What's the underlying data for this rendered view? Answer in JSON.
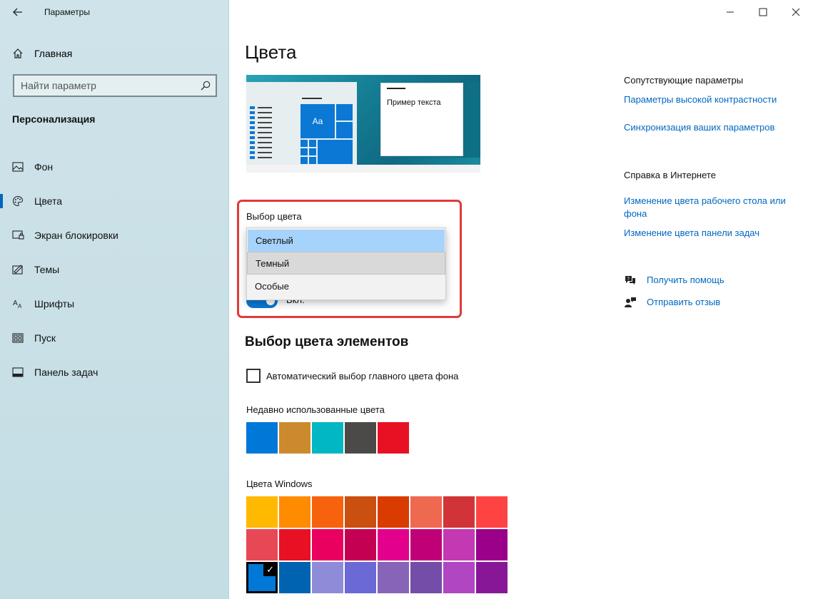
{
  "app": {
    "title": "Параметры"
  },
  "sidebar": {
    "home_label": "Главная",
    "search_placeholder": "Найти параметр",
    "section_title": "Персонализация",
    "items": [
      {
        "label": "Фон",
        "icon": "image-icon"
      },
      {
        "label": "Цвета",
        "icon": "palette-icon",
        "active": true
      },
      {
        "label": "Экран блокировки",
        "icon": "lock-screen-icon"
      },
      {
        "label": "Темы",
        "icon": "themes-icon"
      },
      {
        "label": "Шрифты",
        "icon": "fonts-icon"
      },
      {
        "label": "Пуск",
        "icon": "start-icon"
      },
      {
        "label": "Панель задач",
        "icon": "taskbar-icon"
      }
    ]
  },
  "main": {
    "title": "Цвета",
    "preview_text": "Пример текста",
    "preview_tile_label": "Aa",
    "choose_color_label": "Выбор цвета",
    "dropdown_options": [
      "Светлый",
      "Темный",
      "Особые"
    ],
    "dropdown_selected": "Светлый",
    "toggle_text": "Вкл.",
    "accent_heading": "Выбор цвета элементов",
    "auto_accent_label": "Автоматический выбор главного цвета фона",
    "recent_label": "Недавно использованные цвета",
    "recent_colors": [
      "#0078d7",
      "#cc8a2e",
      "#00b7c3",
      "#4c4a48",
      "#e81123"
    ],
    "windows_colors_label": "Цвета Windows",
    "windows_colors": [
      [
        "#ffb900",
        "#ff8c00",
        "#f7630c",
        "#ca5010",
        "#da3b01",
        "#ef6950",
        "#d13438",
        "#ff4343"
      ],
      [
        "#e74856",
        "#e81123",
        "#ea005e",
        "#c30052",
        "#e3008c",
        "#bf0077",
        "#c239b3",
        "#9a0089"
      ],
      [
        "#0078d7",
        "#0063b1",
        "#8e8cd8",
        "#6b69d6",
        "#8764b8",
        "#744da9",
        "#b146c2",
        "#881798"
      ]
    ],
    "selected_color": "#0078d7"
  },
  "right": {
    "related_title": "Сопутствующие параметры",
    "related_links": [
      "Параметры высокой контрастности",
      "Синхронизация ваших параметров"
    ],
    "help_title": "Справка в Интернете",
    "help_links": [
      "Изменение цвета рабочего стола или фона",
      "Изменение цвета панели задач"
    ],
    "get_help": "Получить помощь",
    "feedback": "Отправить отзыв"
  }
}
